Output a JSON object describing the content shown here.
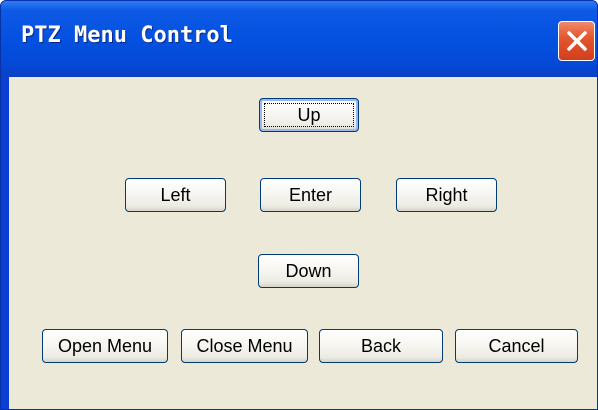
{
  "window": {
    "title": "PTZ Menu Control"
  },
  "buttons": {
    "up": "Up",
    "left": "Left",
    "enter": "Enter",
    "right": "Right",
    "down": "Down",
    "open_menu": "Open Menu",
    "close_menu": "Close Menu",
    "back": "Back",
    "cancel": "Cancel"
  },
  "icons": {
    "close": "close-icon"
  },
  "colors": {
    "titlebar": "#0451e0",
    "client_background": "#ece9d8",
    "close_button": "#e4572f",
    "button_border": "#003c74"
  }
}
